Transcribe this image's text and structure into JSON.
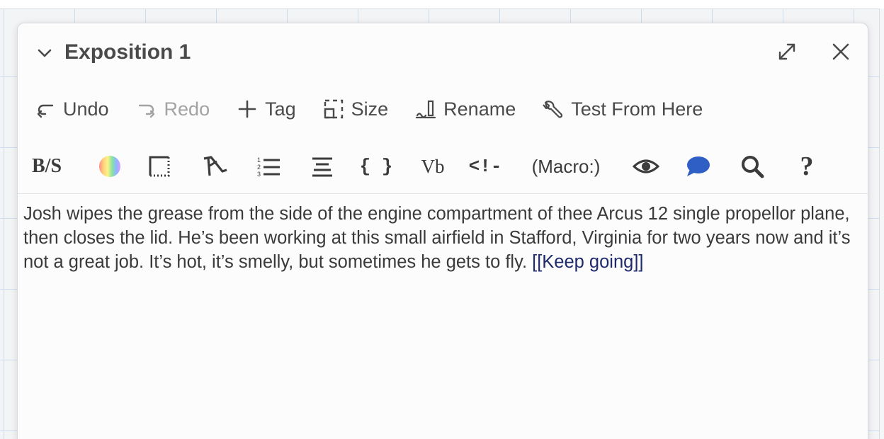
{
  "dialog": {
    "title": "Exposition 1"
  },
  "toolbar": {
    "undo_label": "Undo",
    "redo_label": "Redo",
    "tag_label": "Tag",
    "size_label": "Size",
    "rename_label": "Rename",
    "test_label": "Test From Here"
  },
  "format_toolbar": {
    "bold_strike_label": "B/S",
    "verbatim_label": "Vb",
    "braces_label": "{ }",
    "comment_label": "<!-",
    "macro_label": "(Macro:)",
    "help_label": "?",
    "comment_icon_color": "#2f5fc4"
  },
  "editor": {
    "text": "Josh wipes the grease from the side of the engine compartment of thee Arcus 12 single propellor plane, then closes the lid. He’s been working at this small airfield in Stafford, Virginia for two years now and it’s not a great job. It’s hot, it’s smelly, but sometimes he gets to fly.",
    "link_text": "[[Keep going]]"
  }
}
